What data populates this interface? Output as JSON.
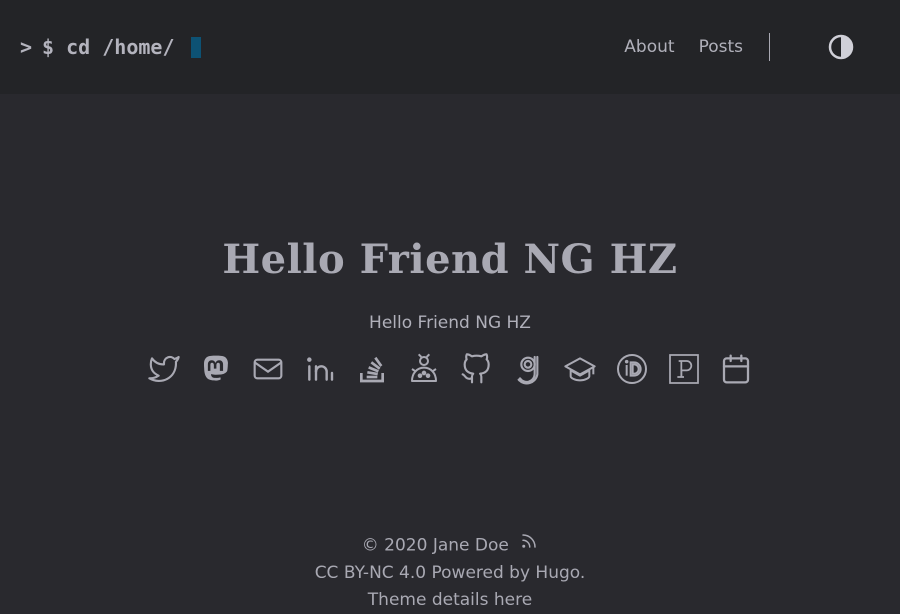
{
  "header": {
    "logo_prompt": ">",
    "logo_text": "$ cd /home/",
    "nav": [
      {
        "label": "About"
      },
      {
        "label": "Posts"
      }
    ]
  },
  "main": {
    "title": "Hello Friend NG HZ",
    "subtitle": "Hello Friend NG HZ",
    "social_icons": [
      "twitter-icon",
      "mastodon-icon",
      "email-icon",
      "linkedin-icon",
      "stackoverflow-icon",
      "bug-icon",
      "github-icon",
      "goodreads-icon",
      "scholar-icon",
      "orcid-icon",
      "patreon-icon",
      "calendar-icon"
    ]
  },
  "footer": {
    "copyright": "© 2020 Jane Doe",
    "license": "CC BY-NC 4.0 Powered by Hugo.",
    "theme": "Theme details here"
  },
  "colors": {
    "background": "#29292e",
    "header": "#232427",
    "text": "#a9a9b3",
    "cursor": "#0d5274"
  }
}
